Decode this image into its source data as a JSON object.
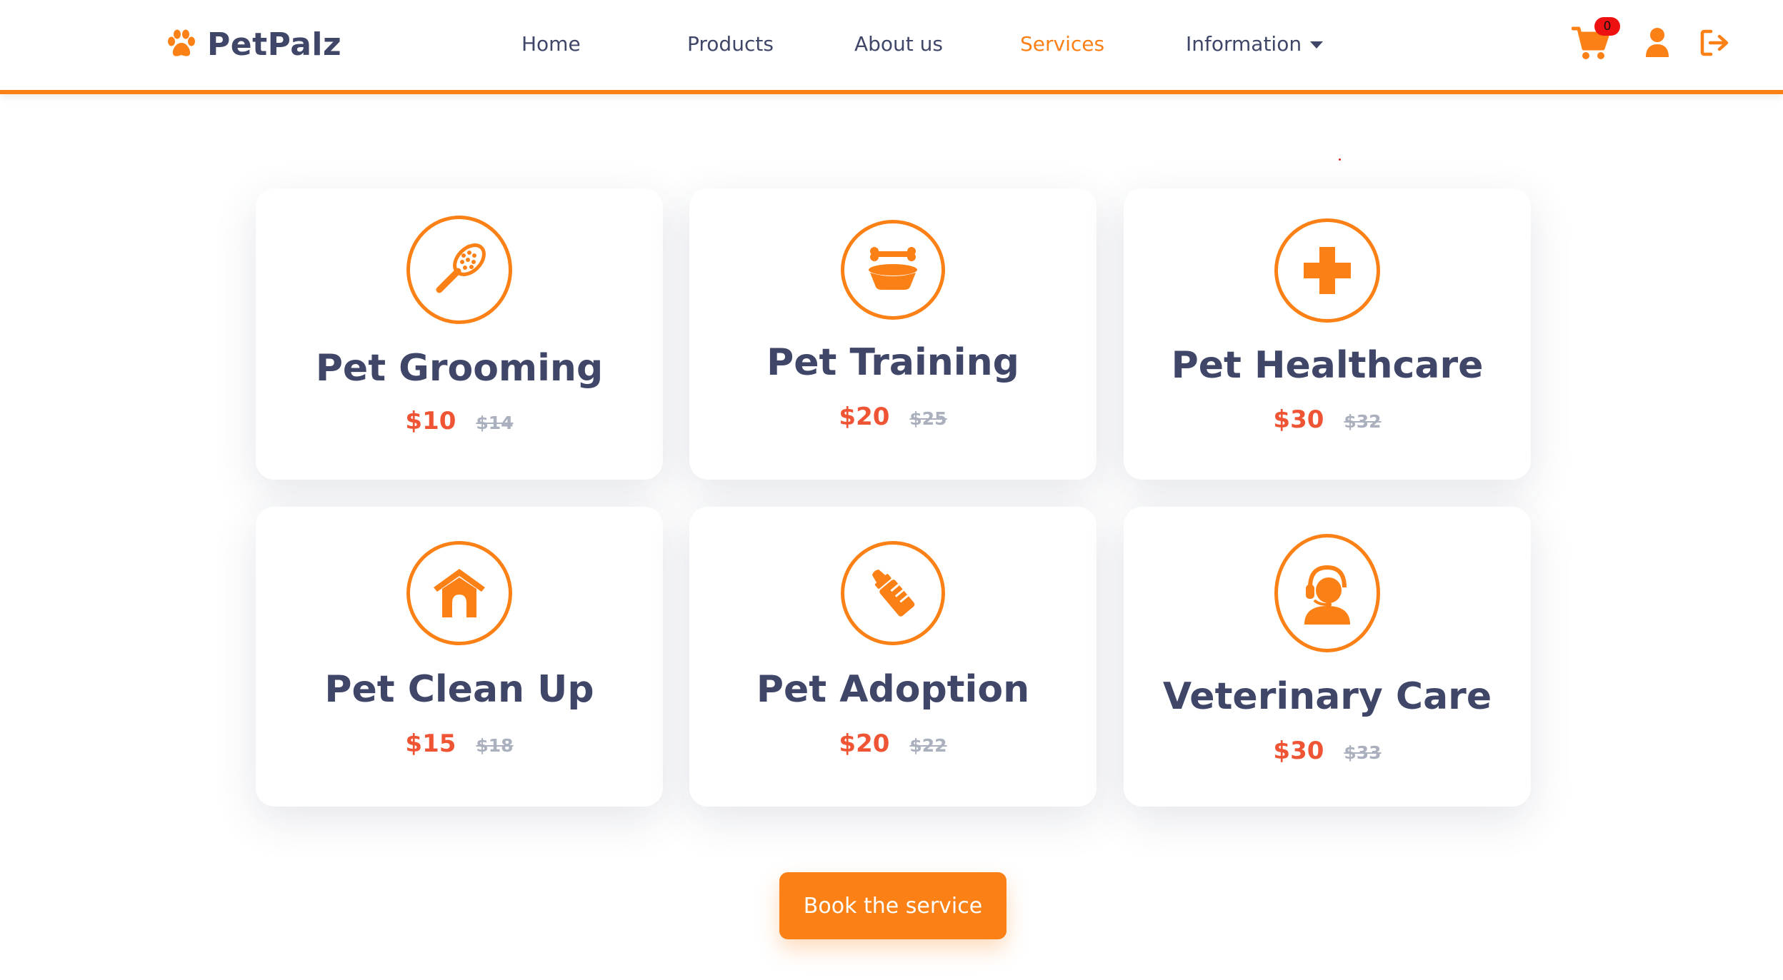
{
  "brand": {
    "name": "PetPalz",
    "icon": "paw-icon"
  },
  "nav": {
    "items": [
      {
        "label": "Home"
      },
      {
        "label": "Products"
      },
      {
        "label": "About us"
      },
      {
        "label": "Services",
        "active": true
      },
      {
        "label": "Information",
        "dropdown": true
      }
    ]
  },
  "header_actions": {
    "cart_icon": "shopping-cart-icon",
    "cart_count": "0",
    "user_icon": "user-icon",
    "logout_icon": "sign-out-icon"
  },
  "services": [
    {
      "title": "Pet Grooming",
      "price": "$10",
      "old_price": "$14",
      "icon": "grooming-brush-icon"
    },
    {
      "title": "Pet Training",
      "price": "$20",
      "old_price": "$25",
      "icon": "bone-bowl-icon"
    },
    {
      "title": "Pet Healthcare",
      "price": "$30",
      "old_price": "$32",
      "icon": "medical-cross-icon"
    },
    {
      "title": "Pet Clean Up",
      "price": "$15",
      "old_price": "$18",
      "icon": "dog-house-icon"
    },
    {
      "title": "Pet Adoption",
      "price": "$20",
      "old_price": "$22",
      "icon": "feeding-bottle-icon"
    },
    {
      "title": "Veterinary Care",
      "price": "$30",
      "old_price": "$33",
      "icon": "vet-headset-icon"
    }
  ],
  "cta": {
    "label": "Book the service"
  },
  "colors": {
    "accent": "#fb8016",
    "text": "#3f4668",
    "price": "#ef5535",
    "old_price": "#aab0bd"
  }
}
